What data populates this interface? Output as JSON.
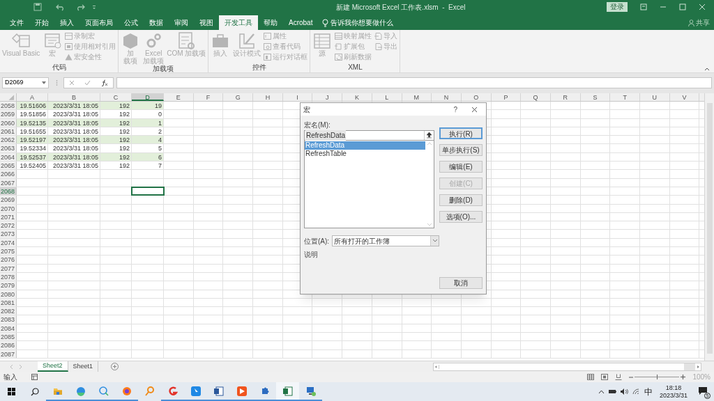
{
  "title_bar": {
    "title": "新建 Microsoft Excel 工作表.xlsm  -  Excel",
    "sign_in": "登录"
  },
  "tabs": [
    {
      "label": "文件",
      "selected": false
    },
    {
      "label": "开始",
      "selected": false
    },
    {
      "label": "插入",
      "selected": false
    },
    {
      "label": "页面布局",
      "selected": false
    },
    {
      "label": "公式",
      "selected": false
    },
    {
      "label": "数据",
      "selected": false
    },
    {
      "label": "审阅",
      "selected": false
    },
    {
      "label": "视图",
      "selected": false
    },
    {
      "label": "开发工具",
      "selected": true
    },
    {
      "label": "帮助",
      "selected": false
    },
    {
      "label": "Acrobat",
      "selected": false
    }
  ],
  "tell_me": "告诉我你想要做什么",
  "share": "共享",
  "ribbon": {
    "disabled": true,
    "groups": [
      {
        "label": "代码",
        "items": [
          {
            "kind": "large",
            "label": "Visual Basic"
          },
          {
            "kind": "large",
            "label": "宏"
          },
          {
            "kind": "small",
            "label": "录制宏"
          },
          {
            "kind": "small",
            "label": "使用相对引用"
          },
          {
            "kind": "small",
            "label": "宏安全性"
          }
        ]
      },
      {
        "label": "加载项",
        "items": [
          {
            "kind": "large",
            "lines": [
              "加",
              "载项"
            ]
          },
          {
            "kind": "large",
            "lines": [
              "Excel",
              "加载项"
            ]
          },
          {
            "kind": "large",
            "label": "COM 加载项"
          }
        ]
      },
      {
        "label": "控件",
        "items": [
          {
            "kind": "large",
            "label": "插入"
          },
          {
            "kind": "large",
            "label": "设计模式"
          },
          {
            "kind": "small",
            "label": "属性"
          },
          {
            "kind": "small",
            "label": "查看代码"
          },
          {
            "kind": "small",
            "label": "运行对话框"
          }
        ]
      },
      {
        "label": "XML",
        "items": [
          {
            "kind": "large",
            "label": "源"
          },
          {
            "kind": "small",
            "label": "映射属性"
          },
          {
            "kind": "small",
            "label": "扩展包"
          },
          {
            "kind": "small",
            "label": "刷新数据"
          },
          {
            "kind": "small",
            "label": "导入"
          },
          {
            "kind": "small",
            "label": "导出"
          }
        ]
      }
    ]
  },
  "formula_bar": {
    "name_box": "D2069"
  },
  "sheet": {
    "columns": [
      {
        "label": "A",
        "selected": false
      },
      {
        "label": "B",
        "selected": false
      },
      {
        "label": "C",
        "selected": false
      },
      {
        "label": "D",
        "selected": true
      },
      {
        "label": "E",
        "selected": false
      },
      {
        "label": "F",
        "selected": false
      },
      {
        "label": "G",
        "selected": false
      },
      {
        "label": "H",
        "selected": false
      },
      {
        "label": "I",
        "selected": false
      },
      {
        "label": "J",
        "selected": false
      },
      {
        "label": "K",
        "selected": false
      },
      {
        "label": "L",
        "selected": false
      },
      {
        "label": "M",
        "selected": false
      },
      {
        "label": "N",
        "selected": false
      },
      {
        "label": "O",
        "selected": false
      },
      {
        "label": "P",
        "selected": false
      },
      {
        "label": "Q",
        "selected": false
      },
      {
        "label": "R",
        "selected": false
      },
      {
        "label": "S",
        "selected": false
      },
      {
        "label": "T",
        "selected": false
      },
      {
        "label": "U",
        "selected": false
      },
      {
        "label": "V",
        "selected": false
      }
    ],
    "rows": [
      {
        "number": "2058",
        "selected": false,
        "banded": true,
        "cells": [
          "19.51606",
          "2023/3/31 18:05",
          "192",
          "19"
        ]
      },
      {
        "number": "2059",
        "selected": false,
        "banded": false,
        "cells": [
          "19.51856",
          "2023/3/31 18:05",
          "192",
          "0"
        ]
      },
      {
        "number": "2060",
        "selected": false,
        "banded": true,
        "cells": [
          "19.52135",
          "2023/3/31 18:05",
          "192",
          "1"
        ]
      },
      {
        "number": "2061",
        "selected": false,
        "banded": false,
        "cells": [
          "19.51655",
          "2023/3/31 18:05",
          "192",
          "2"
        ]
      },
      {
        "number": "2062",
        "selected": false,
        "banded": true,
        "cells": [
          "19.52197",
          "2023/3/31 18:05",
          "192",
          "4"
        ]
      },
      {
        "number": "2063",
        "selected": false,
        "banded": false,
        "cells": [
          "19.52334",
          "2023/3/31 18:05",
          "192",
          "5"
        ]
      },
      {
        "number": "2064",
        "selected": false,
        "banded": true,
        "cells": [
          "19.52537",
          "2023/3/31 18:05",
          "192",
          "6"
        ]
      },
      {
        "number": "2065",
        "selected": false,
        "banded": false,
        "cells": [
          "19.52405",
          "2023/3/31 18:05",
          "192",
          "7"
        ]
      },
      {
        "number": "2066",
        "selected": false
      },
      {
        "number": "2067",
        "selected": false
      },
      {
        "number": "2068",
        "selected": true
      },
      {
        "number": "2069",
        "selected": false
      },
      {
        "number": "2070",
        "selected": false
      },
      {
        "number": "2071",
        "selected": false
      },
      {
        "number": "2072",
        "selected": false
      },
      {
        "number": "2073",
        "selected": false
      },
      {
        "number": "2074",
        "selected": false
      },
      {
        "number": "2075",
        "selected": false
      },
      {
        "number": "2076",
        "selected": false
      },
      {
        "number": "2077",
        "selected": false
      },
      {
        "number": "2078",
        "selected": false
      },
      {
        "number": "2079",
        "selected": false
      },
      {
        "number": "2080",
        "selected": false
      },
      {
        "number": "2081",
        "selected": false
      },
      {
        "number": "2082",
        "selected": false
      },
      {
        "number": "2083",
        "selected": false
      },
      {
        "number": "2084",
        "selected": false
      },
      {
        "number": "2085",
        "selected": false
      },
      {
        "number": "2086",
        "selected": false
      },
      {
        "number": "2087",
        "selected": false
      }
    ]
  },
  "dialog": {
    "title": "宏",
    "help": "?",
    "name_label": "宏名(M):",
    "name_value": "RefreshData",
    "macros": [
      {
        "label": "RefreshData",
        "selected": true
      },
      {
        "label": "RefreshTable",
        "selected": false
      }
    ],
    "buttons": [
      {
        "label": "执行(R)",
        "default": true,
        "disabled": false
      },
      {
        "label": "单步执行(S)",
        "default": false,
        "disabled": false
      },
      {
        "label": "编辑(E)",
        "default": false,
        "disabled": false
      },
      {
        "label": "创建(C)",
        "default": false,
        "disabled": true
      },
      {
        "label": "删除(D)",
        "default": false,
        "disabled": false
      },
      {
        "label": "选项(O)...",
        "default": false,
        "disabled": false
      }
    ],
    "location_label": "位置(A):",
    "location_value": "所有打开的工作簿",
    "description_label": "说明",
    "cancel": "取消"
  },
  "sheet_tabs": [
    {
      "label": "Sheet2",
      "selected": true
    },
    {
      "label": "Sheet1",
      "selected": false
    }
  ],
  "status_bar": {
    "mode": "输入",
    "zoom": "100%",
    "level": 0.5
  },
  "taskbar": {
    "apps": [
      {
        "kind": "files",
        "running": true,
        "active": false
      },
      {
        "kind": "edge",
        "running": true,
        "active": false
      },
      {
        "kind": "chat",
        "running": true,
        "active": false
      },
      {
        "kind": "firefox",
        "running": true,
        "active": false
      },
      {
        "kind": "magnifier",
        "running": false,
        "active": false
      },
      {
        "kind": "swirl",
        "running": true,
        "active": false
      },
      {
        "kind": "cursor",
        "running": true,
        "active": false
      },
      {
        "kind": "word",
        "running": true,
        "active": false
      },
      {
        "kind": "play",
        "running": true,
        "active": false
      },
      {
        "kind": "puzzle",
        "running": true,
        "active": false
      },
      {
        "kind": "excel",
        "running": true,
        "active": true
      },
      {
        "kind": "computer",
        "running": true,
        "active": false
      }
    ],
    "ime": "中",
    "time": "18:18",
    "date": "2023/3/31",
    "notifications": "5"
  }
}
